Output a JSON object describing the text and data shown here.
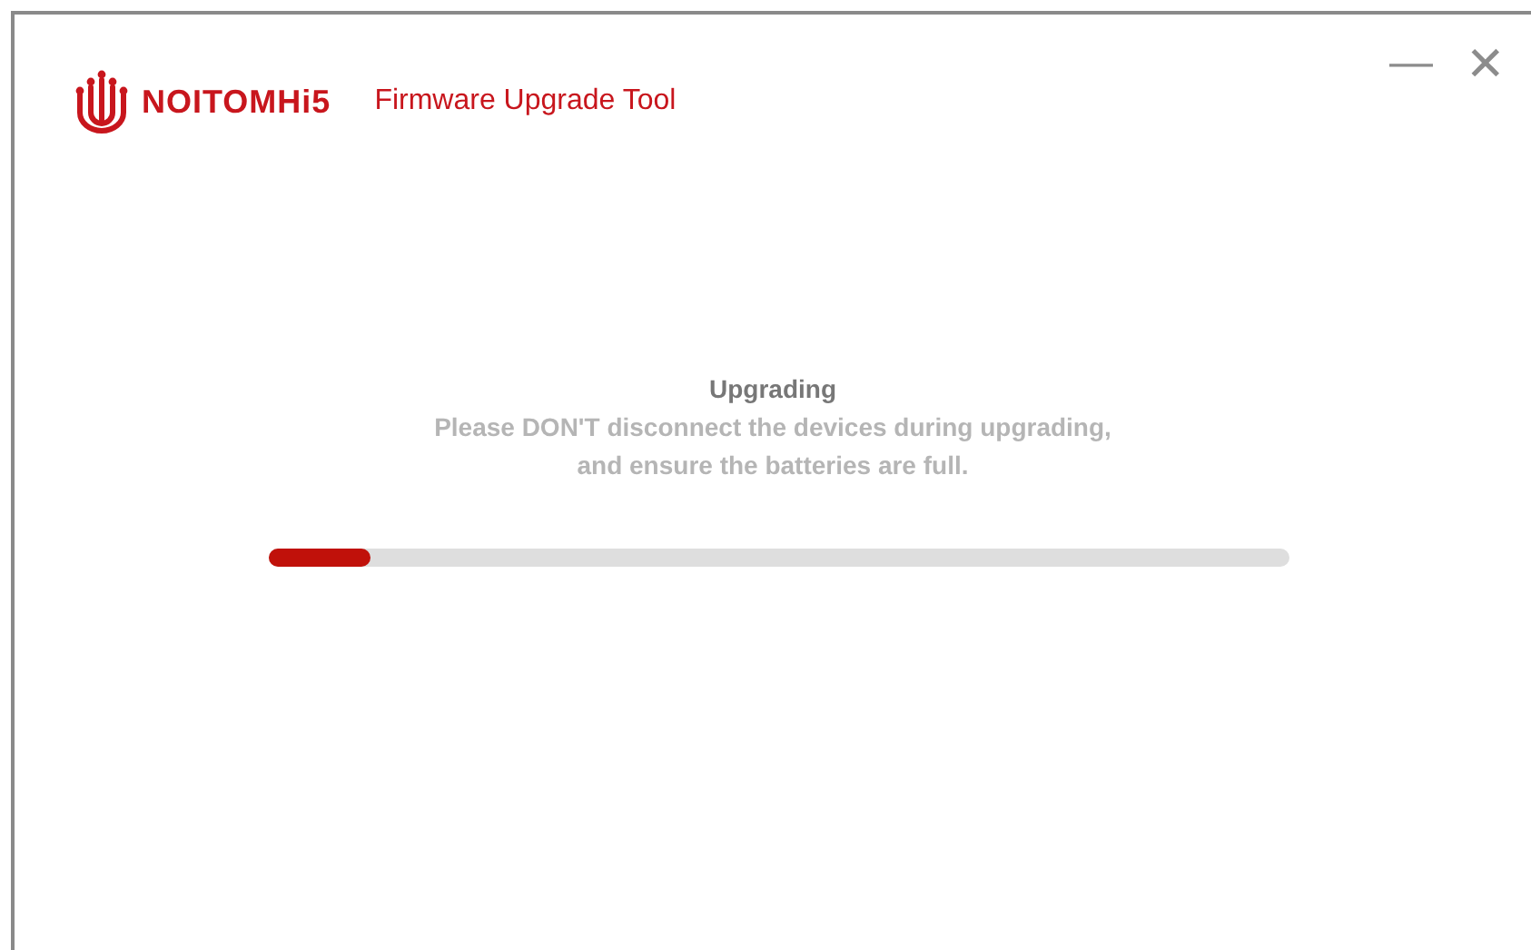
{
  "header": {
    "logo_text": "NOITOMHi5",
    "title": "Firmware Upgrade Tool"
  },
  "window_controls": {
    "minimize": "—",
    "close": "✕"
  },
  "status": {
    "heading": "Upgrading",
    "message": [
      "Please DON'T disconnect the devices during upgrading,",
      "and ensure the batteries are full."
    ]
  },
  "progress": {
    "level": 0.1
  }
}
